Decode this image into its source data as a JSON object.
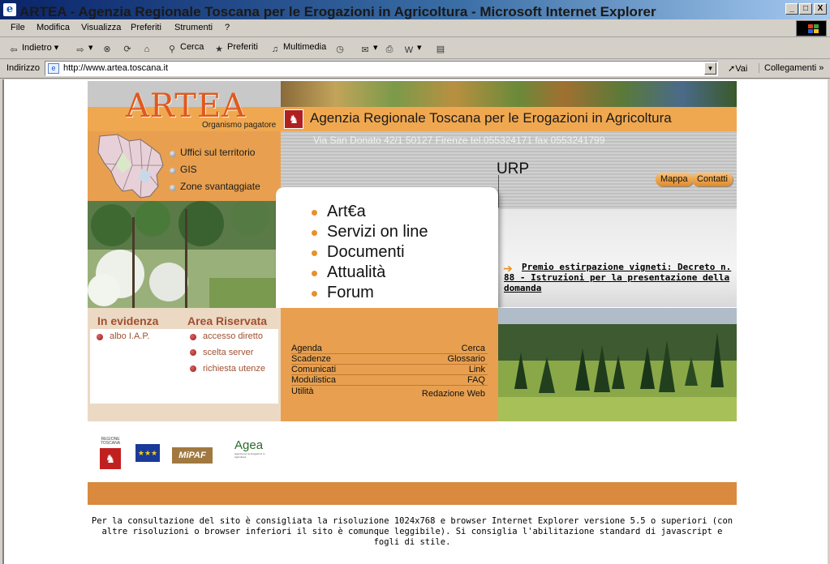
{
  "window": {
    "title": "ARTEA - Agenzia Regionale Toscana per le Erogazioni in Agricoltura - Microsoft Internet Explorer",
    "controls": [
      "_",
      "□",
      "X"
    ]
  },
  "menubar": {
    "items": [
      "File",
      "Modifica",
      "Visualizza",
      "Preferiti",
      "Strumenti",
      "?"
    ]
  },
  "toolbar": {
    "back": "Indietro",
    "search": "Cerca",
    "favorites": "Preferiti",
    "multimedia": "Multimedia"
  },
  "addressbar": {
    "label": "Indirizzo",
    "url": "http://www.artea.toscana.it",
    "go": "Vai",
    "links": "Collegamenti"
  },
  "page": {
    "logo": {
      "text": "ARTEA",
      "subtitle": "Organismo pagatore"
    },
    "agency_title": "Agenzia Regionale Toscana per le Erogazioni in Agricoltura",
    "address_line": "Via San Donato 42/1 50127 Firenze tel.055324171 fax 0553241799",
    "urp": "URP",
    "pills": {
      "mappa": "Mappa",
      "contatti": "Contatti"
    },
    "side_links": [
      "Uffici sul territorio",
      "GIS",
      "Zone svantaggiate"
    ],
    "main_menu": [
      "Art€a",
      "Servizi on line",
      "Documenti",
      "Attualità",
      "Forum"
    ],
    "news": "Premio estirpazione vigneti: Decreto n. 88 - Istruzioni per la presentazione della domanda",
    "in_evidenza": {
      "title": "In evidenza",
      "items": [
        "albo I.A.P."
      ]
    },
    "area_riservata": {
      "title": "Area Riservata",
      "items": [
        "accesso diretto",
        "scelta server",
        "richiesta utenze"
      ]
    },
    "links_left": [
      "Agenda",
      "Scadenze",
      "Comunicati",
      "Modulistica",
      "Utilità"
    ],
    "links_right": [
      "Cerca",
      "Glossario",
      "Link",
      "FAQ",
      "Redazione Web"
    ],
    "partner_logos": {
      "regione": "REGIONE TOSCANA",
      "mipaf": "MiPAF",
      "agea": "Agea",
      "agea_sub": "Agenzia per le Erogazioni in Agricoltura"
    },
    "footer": "Per la consultazione del sito è consigliata la risoluzione 1024x768 e browser Internet Explorer versione 5.5 o superiori (con altre risoluzioni o browser inferiori il sito è comunque leggibile). Si consiglia l'abilitazione standard di javascript e fogli di stile."
  },
  "colors": {
    "orange": "#f0a850",
    "dark_orange": "#d98a3e",
    "title_blue": "#0a246a",
    "evidence_red": "#a05030"
  }
}
